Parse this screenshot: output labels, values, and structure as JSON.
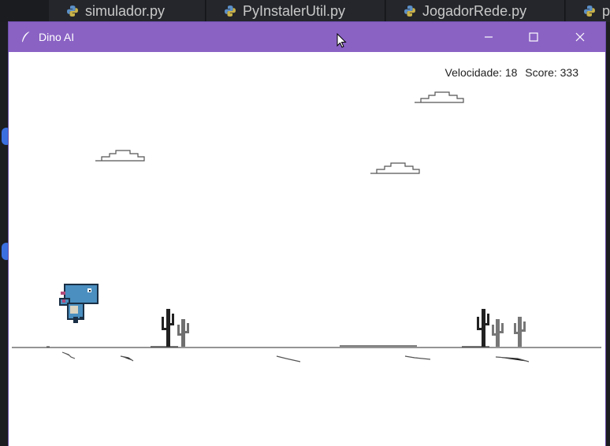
{
  "editor": {
    "tabs": [
      {
        "label": "simulador.py"
      },
      {
        "label": "PyInstalerUtil.py"
      },
      {
        "label": "JogadorRede.py"
      },
      {
        "label": "p"
      }
    ]
  },
  "window": {
    "title": "Dino AI",
    "controls": {
      "minimize": "minimize",
      "maximize": "maximize",
      "close": "close"
    }
  },
  "hud": {
    "speed_label": "Velocidade: 18",
    "score_label": "Score: 333"
  },
  "game": {
    "speed": 18,
    "score": 333,
    "clouds": 3,
    "cacti_groups": 2
  },
  "colors": {
    "titlebar": "#8a62c4",
    "dino": "#4a8fc0",
    "ground": "#555555"
  }
}
